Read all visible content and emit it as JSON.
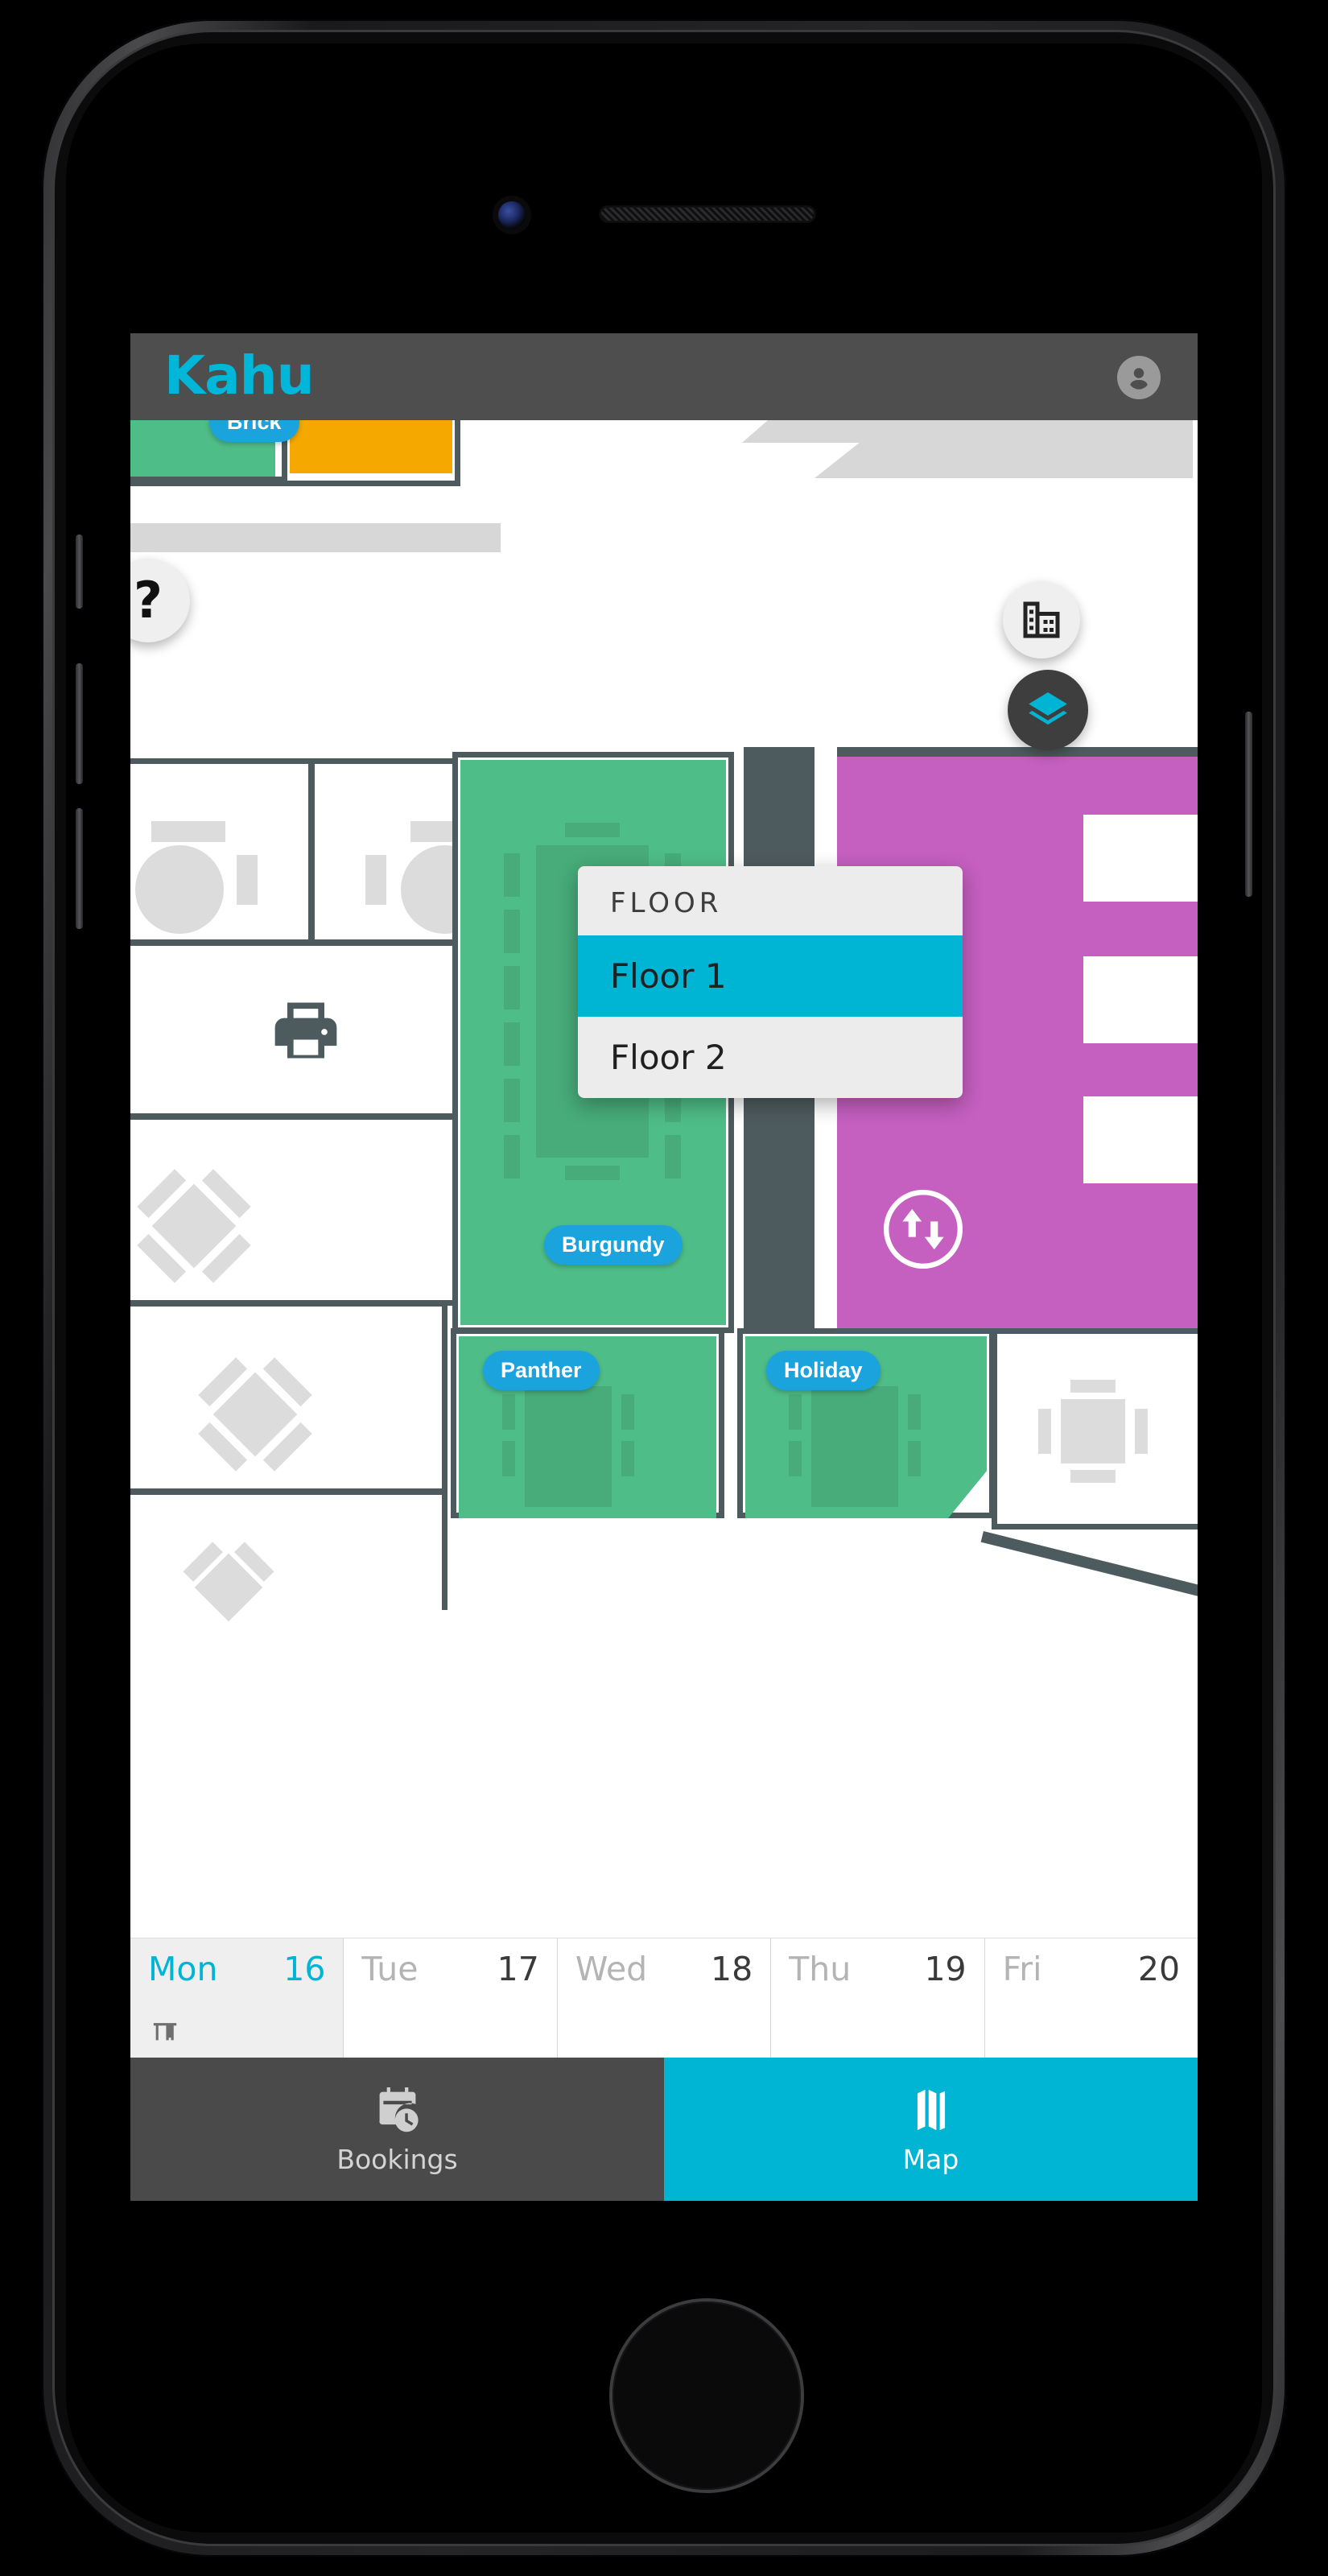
{
  "app": {
    "header": {
      "brand": "Kahu",
      "avatar_icon": "account-circle-icon"
    },
    "accent_cyan": "#00b5d4",
    "brand_cyan": "#00b7da",
    "pill_blue": "#1ba3de",
    "room_green": "#4fbd87",
    "room_orange": "#f5a800",
    "room_magenta": "#c55fc0",
    "wall_grey": "#4e5b5e",
    "header_grey": "#4e4e4e"
  },
  "floor_dropdown": {
    "title": "FLOOR",
    "options": [
      {
        "label": "Floor 1",
        "selected": true
      },
      {
        "label": "Floor 2",
        "selected": false
      }
    ]
  },
  "map": {
    "room_labels": [
      {
        "name": "Brick"
      },
      {
        "name": "Burgundy"
      },
      {
        "name": "Panther"
      },
      {
        "name": "Holiday"
      }
    ],
    "icons": {
      "help": "question-mark-icon",
      "building": "building-icon",
      "layers": "layers-icon",
      "lift": "lift-up-down-icon",
      "locate": "center-focus-icon",
      "printer": "printer-icon"
    }
  },
  "date_strip": {
    "days": [
      {
        "dow": "Mon",
        "num": "16",
        "selected": true,
        "marker": "desk-icon"
      },
      {
        "dow": "Tue",
        "num": "17",
        "selected": false,
        "marker": ""
      },
      {
        "dow": "Wed",
        "num": "18",
        "selected": false,
        "marker": ""
      },
      {
        "dow": "Thu",
        "num": "19",
        "selected": false,
        "marker": ""
      },
      {
        "dow": "Fri",
        "num": "20",
        "selected": false,
        "marker": ""
      }
    ]
  },
  "tab_bar": {
    "tabs": [
      {
        "label": "Bookings",
        "icon": "booking-clock-icon",
        "active": false
      },
      {
        "label": "Map",
        "icon": "map-icon",
        "active": true
      }
    ]
  }
}
